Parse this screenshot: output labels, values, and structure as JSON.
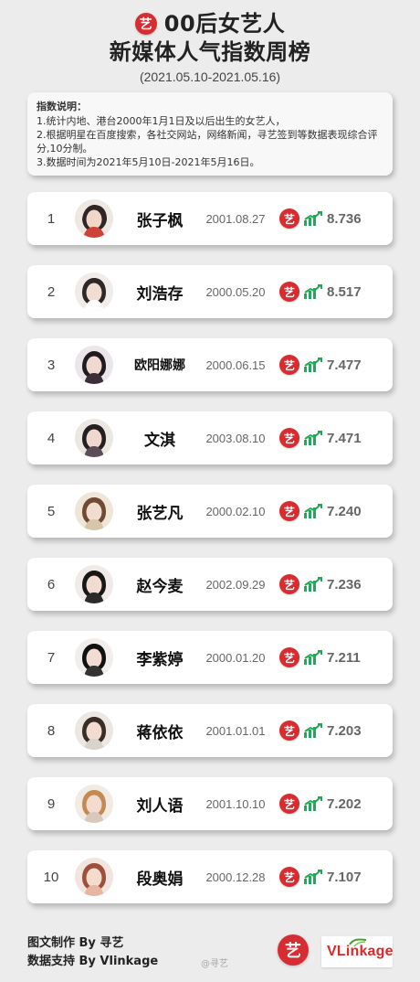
{
  "header": {
    "badge_text": "艺",
    "title_line1": "00后女艺人",
    "title_line2": "新媒体人气指数周榜",
    "date_range": "(2021.05.10-2021.05.16)"
  },
  "notes": {
    "title": "指数说明：",
    "items": [
      "1.统计内地、港台2000年1月1日及以后出生的女艺人，",
      "2.根据明星在百度搜索，各社交网站，网络新闻，寻艺签到等数据表现综合评分,10分制。",
      "3.数据时间为2021年5月10日-2021年5月16日。"
    ]
  },
  "ranking": [
    {
      "rank": "1",
      "name": "张子枫",
      "dob": "2001.08.27",
      "score": "8.736"
    },
    {
      "rank": "2",
      "name": "刘浩存",
      "dob": "2000.05.20",
      "score": "8.517"
    },
    {
      "rank": "3",
      "name": "欧阳娜娜",
      "dob": "2000.06.15",
      "score": "7.477"
    },
    {
      "rank": "4",
      "name": "文淇",
      "dob": "2003.08.10",
      "score": "7.471"
    },
    {
      "rank": "5",
      "name": "张艺凡",
      "dob": "2000.02.10",
      "score": "7.240"
    },
    {
      "rank": "6",
      "name": "赵今麦",
      "dob": "2002.09.29",
      "score": "7.236"
    },
    {
      "rank": "7",
      "name": "李紫婷",
      "dob": "2000.01.20",
      "score": "7.211"
    },
    {
      "rank": "8",
      "name": "蒋依依",
      "dob": "2001.01.01",
      "score": "7.203"
    },
    {
      "rank": "9",
      "name": "刘人语",
      "dob": "2001.10.10",
      "score": "7.202"
    },
    {
      "rank": "10",
      "name": "段奥娟",
      "dob": "2000.12.28",
      "score": "7.107"
    }
  ],
  "footer": {
    "credit_line1": "图文制作 By 寻艺",
    "credit_line2": "数据支持 By Vlinkage",
    "watermark": "@寻艺",
    "brand_badge": "艺",
    "vlinkage_text": "VLinkage"
  },
  "colors": {
    "brand_red": "#d62d32",
    "trend_green": "#22a85a",
    "card_bg": "#ffffff",
    "page_bg": "#ececec"
  },
  "icons": {
    "brand": "brand-badge-icon",
    "trend": "trend-up-icon",
    "avatar": "avatar-icon"
  }
}
